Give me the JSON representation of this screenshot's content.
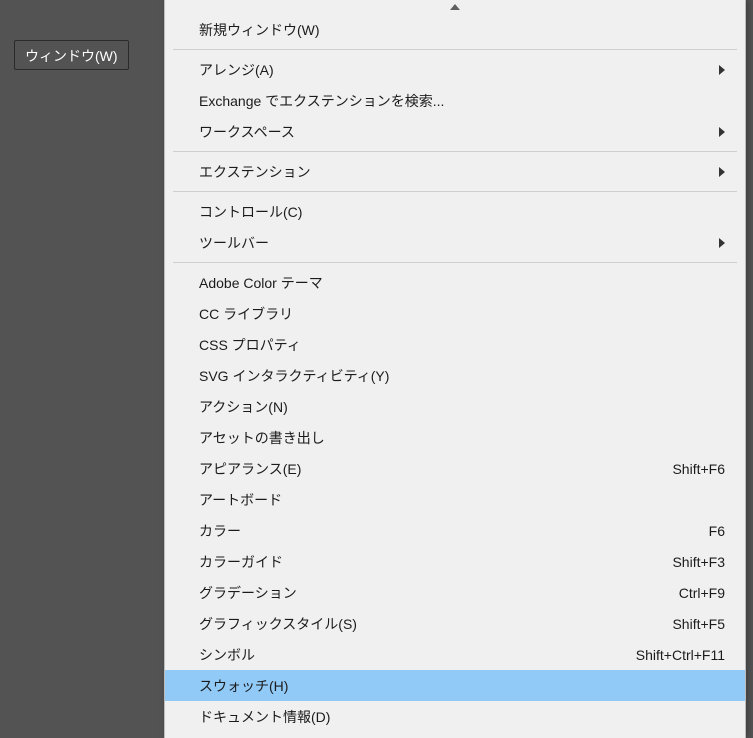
{
  "menu_header": "ウィンドウ(W)",
  "items": [
    {
      "label": "新規ウィンドウ(W)",
      "shortcut": "",
      "submenu": false,
      "highlight": false,
      "sep_after": true
    },
    {
      "label": "アレンジ(A)",
      "shortcut": "",
      "submenu": true,
      "highlight": false,
      "sep_after": false
    },
    {
      "label": "Exchange でエクステンションを検索...",
      "shortcut": "",
      "submenu": false,
      "highlight": false,
      "sep_after": false
    },
    {
      "label": "ワークスペース",
      "shortcut": "",
      "submenu": true,
      "highlight": false,
      "sep_after": true
    },
    {
      "label": "エクステンション",
      "shortcut": "",
      "submenu": true,
      "highlight": false,
      "sep_after": true
    },
    {
      "label": "コントロール(C)",
      "shortcut": "",
      "submenu": false,
      "highlight": false,
      "sep_after": false
    },
    {
      "label": "ツールバー",
      "shortcut": "",
      "submenu": true,
      "highlight": false,
      "sep_after": true
    },
    {
      "label": "Adobe Color テーマ",
      "shortcut": "",
      "submenu": false,
      "highlight": false,
      "sep_after": false
    },
    {
      "label": "CC ライブラリ",
      "shortcut": "",
      "submenu": false,
      "highlight": false,
      "sep_after": false
    },
    {
      "label": "CSS プロパティ",
      "shortcut": "",
      "submenu": false,
      "highlight": false,
      "sep_after": false
    },
    {
      "label": "SVG インタラクティビティ(Y)",
      "shortcut": "",
      "submenu": false,
      "highlight": false,
      "sep_after": false
    },
    {
      "label": "アクション(N)",
      "shortcut": "",
      "submenu": false,
      "highlight": false,
      "sep_after": false
    },
    {
      "label": "アセットの書き出し",
      "shortcut": "",
      "submenu": false,
      "highlight": false,
      "sep_after": false
    },
    {
      "label": "アピアランス(E)",
      "shortcut": "Shift+F6",
      "submenu": false,
      "highlight": false,
      "sep_after": false
    },
    {
      "label": "アートボード",
      "shortcut": "",
      "submenu": false,
      "highlight": false,
      "sep_after": false
    },
    {
      "label": "カラー",
      "shortcut": "F6",
      "submenu": false,
      "highlight": false,
      "sep_after": false
    },
    {
      "label": "カラーガイド",
      "shortcut": "Shift+F3",
      "submenu": false,
      "highlight": false,
      "sep_after": false
    },
    {
      "label": "グラデーション",
      "shortcut": "Ctrl+F9",
      "submenu": false,
      "highlight": false,
      "sep_after": false
    },
    {
      "label": "グラフィックスタイル(S)",
      "shortcut": "Shift+F5",
      "submenu": false,
      "highlight": false,
      "sep_after": false
    },
    {
      "label": "シンボル",
      "shortcut": "Shift+Ctrl+F11",
      "submenu": false,
      "highlight": false,
      "sep_after": false
    },
    {
      "label": "スウォッチ(H)",
      "shortcut": "",
      "submenu": false,
      "highlight": true,
      "sep_after": false
    },
    {
      "label": "ドキュメント情報(D)",
      "shortcut": "",
      "submenu": false,
      "highlight": false,
      "sep_after": false
    }
  ]
}
